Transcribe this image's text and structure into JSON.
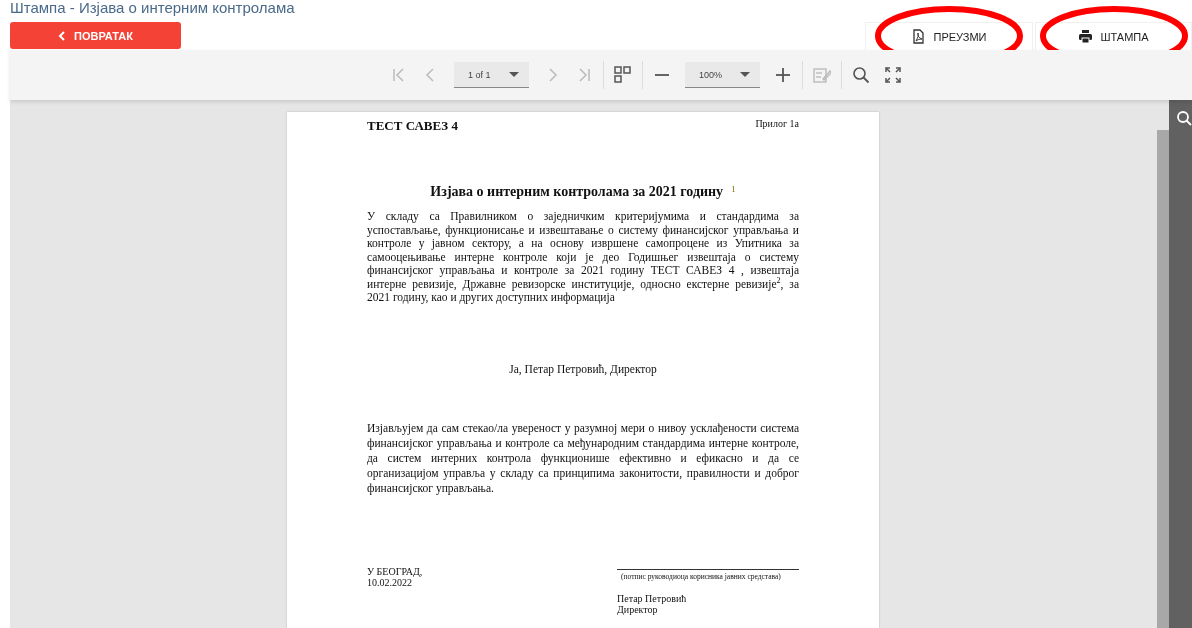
{
  "page_title": "Штампа - Изјава о интерним контролама",
  "back_button": {
    "label": "ПОВРАТАК"
  },
  "actions": [
    {
      "kind": "download",
      "label": "ПРЕУЗМИ",
      "highlighted": true
    },
    {
      "kind": "print",
      "label": "ШТАМПА",
      "highlighted": true
    }
  ],
  "toolbar": [
    {
      "kind": "first",
      "disabled": true
    },
    {
      "kind": "prev",
      "disabled": true
    },
    {
      "kind": "page_select",
      "value": "1 of 1"
    },
    {
      "kind": "next",
      "disabled": true
    },
    {
      "kind": "last",
      "disabled": true
    },
    {
      "kind": "sep"
    },
    {
      "kind": "thumbnails",
      "disabled": false
    },
    {
      "kind": "sep"
    },
    {
      "kind": "zoom_out",
      "disabled": false
    },
    {
      "kind": "zoom_select",
      "value": "100%"
    },
    {
      "kind": "zoom_in",
      "disabled": false
    },
    {
      "kind": "sep"
    },
    {
      "kind": "annotate",
      "disabled": true
    },
    {
      "kind": "sep"
    },
    {
      "kind": "search",
      "disabled": false
    },
    {
      "kind": "fullscreen",
      "disabled": false
    }
  ],
  "document": {
    "org": "ТЕСТ САВЕЗ 4",
    "annex": "Прилог 1а",
    "title": "Изјава о интерним контролама за 2021 годину",
    "title_note": "1",
    "para1": "У складу са Правилником о заједничким критеријумима и стандардима за успостављање, функционисање и извештавање о систему финансијског управљања и контроле у јавном сектору, а на основу извршене самопроцене из Упитника за самооцењивање интерне контроле који је део Годишњег извештаја о систему финансијског управљања и контроле за 2021 годину ТЕСТ САВЕЗ 4 , извештаја интерне ревизије, Државне ревизорске институције, односно екстерне ревизије$^{2}$, за 2021 годину, као и других доступних информација",
    "signatory": "Ја, Петар Петровић, Директор",
    "para2": "Изјављујем да сам стекао/ла увереност у разумној мери о нивоу усклађености система финансијског управљања и контроле са међународним стандардима интерне контроле, да систем интерних контрола функционише ефективно и ефикасно и да се организацијом управља у складу са принципима законитости, правилности и доброг финансијског управљања.",
    "place": "У БЕОГРАД,",
    "date": "10.02.2022",
    "signature_caption": "(потпис руководиоца корисника јавних средстава)",
    "signer_name": "Петар Петровић",
    "signer_role": "Директор"
  }
}
